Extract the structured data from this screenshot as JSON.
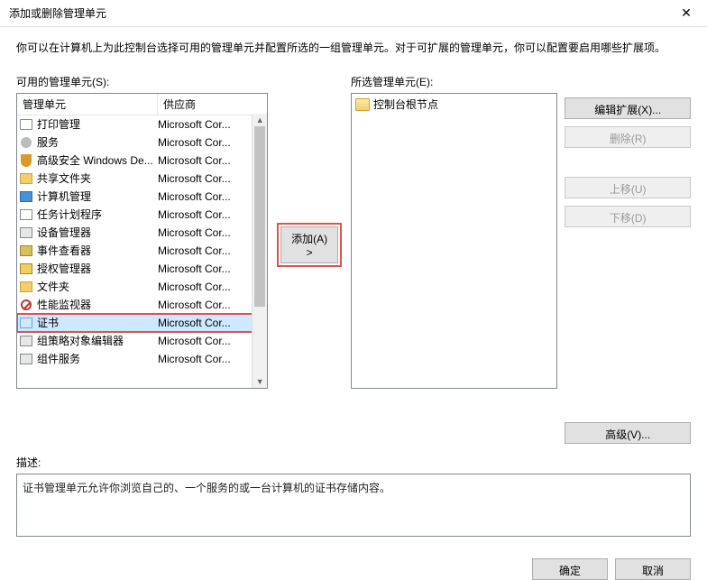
{
  "window": {
    "title": "添加或删除管理单元",
    "intro": "你可以在计算机上为此控制台选择可用的管理单元并配置所选的一组管理单元。对于可扩展的管理单元，你可以配置要启用哪些扩展项。"
  },
  "labels": {
    "available": "可用的管理单元(S):",
    "selected": "所选管理单元(E):",
    "description": "描述:"
  },
  "columns": {
    "name": "管理单元",
    "vendor": "供应商"
  },
  "snapins": [
    {
      "name": "打印管理",
      "vendor": "Microsoft Cor...",
      "icon": "ic-print"
    },
    {
      "name": "服务",
      "vendor": "Microsoft Cor...",
      "icon": "ic-gear"
    },
    {
      "name": "高级安全 Windows De...",
      "vendor": "Microsoft Cor...",
      "icon": "ic-shield"
    },
    {
      "name": "共享文件夹",
      "vendor": "Microsoft Cor...",
      "icon": "ic-folder"
    },
    {
      "name": "计算机管理",
      "vendor": "Microsoft Cor...",
      "icon": "ic-comp"
    },
    {
      "name": "任务计划程序",
      "vendor": "Microsoft Cor...",
      "icon": "ic-task"
    },
    {
      "name": "设备管理器",
      "vendor": "Microsoft Cor...",
      "icon": "ic-dev"
    },
    {
      "name": "事件查看器",
      "vendor": "Microsoft Cor...",
      "icon": "ic-evt"
    },
    {
      "name": "授权管理器",
      "vendor": "Microsoft Cor...",
      "icon": "ic-auth"
    },
    {
      "name": "文件夹",
      "vendor": "Microsoft Cor...",
      "icon": "ic-fld"
    },
    {
      "name": "性能监视器",
      "vendor": "Microsoft Cor...",
      "icon": "ic-no"
    },
    {
      "name": "证书",
      "vendor": "Microsoft Cor...",
      "icon": "ic-cert",
      "selected": true,
      "highlight": true
    },
    {
      "name": "组策略对象编辑器",
      "vendor": "Microsoft Cor...",
      "icon": "ic-gpo"
    },
    {
      "name": "组件服务",
      "vendor": "Microsoft Cor...",
      "icon": "ic-comsvc"
    }
  ],
  "selected_root": "控制台根节点",
  "buttons": {
    "add": "添加(A) >",
    "edit_ext": "编辑扩展(X)...",
    "remove": "删除(R)",
    "up": "上移(U)",
    "down": "下移(D)",
    "advanced": "高级(V)...",
    "ok": "确定",
    "cancel": "取消"
  },
  "description_text": "证书管理单元允许你浏览自己的、一个服务的或一台计算机的证书存储内容。"
}
